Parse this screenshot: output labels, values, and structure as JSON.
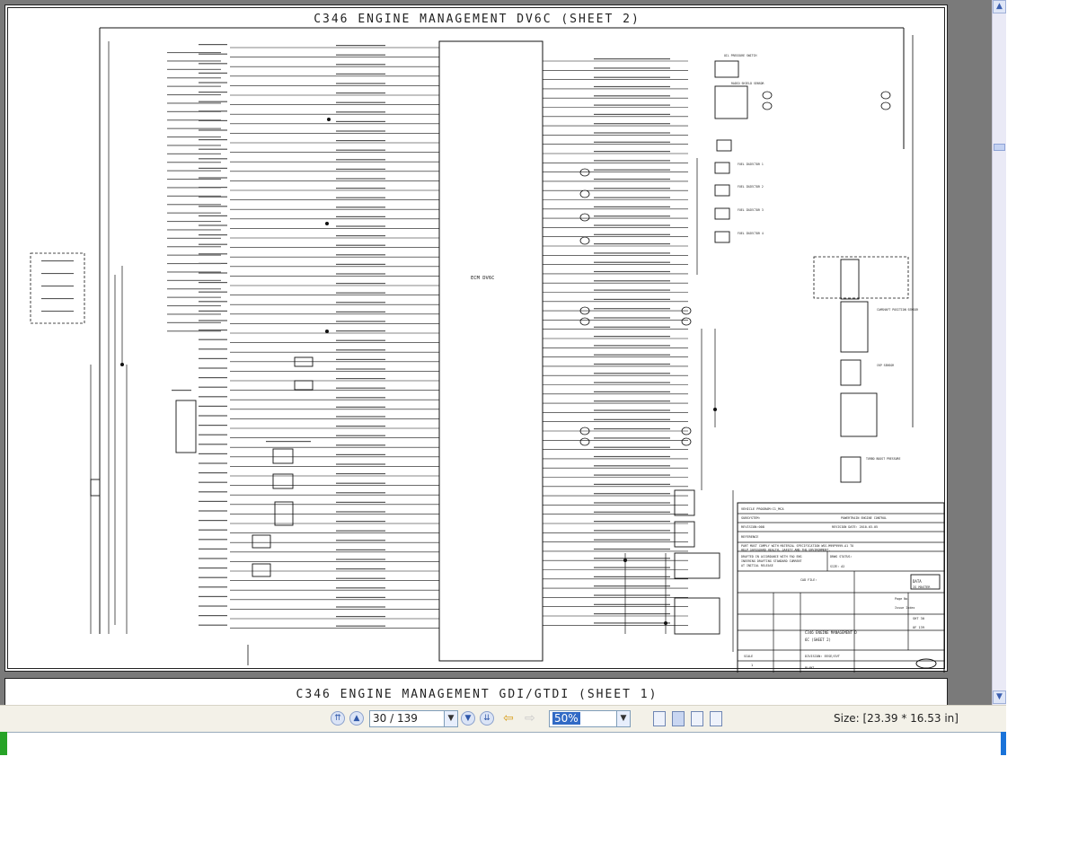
{
  "document": {
    "sheet_title": "C346  ENGINE MANAGEMENT DV6C (SHEET 2)",
    "next_sheet_title": "C346  ENGINE MANAGEMENT GDI/GTDI (SHEET 1)",
    "ecu_label": "ECM DV6C",
    "components_right": [
      "OIL PRESSURE SWITCH",
      "RADIO SHIELD SENSOR",
      "FUEL INJECTOR 1",
      "FUEL INJECTOR 2",
      "FUEL INJECTOR 3",
      "FUEL INJECTOR 4",
      "CAMSHAFT POSITION SENSOR",
      "CKP SENSOR",
      "TURBO BOOST PRESSURE"
    ],
    "title_block": {
      "vehicle_program": "VEHICLE PROGRAM:C1_MCA",
      "subsystem": "SUBSYSTEM:",
      "subsystem_value": "POWERTRAIN ENGINE CONTROL",
      "revision": "REVISION:008",
      "revision_date": "REVISION DATE: 2010-03-05",
      "reference": "REFERENCE",
      "compliance": "PART MUST COMPLY WITH MATERIAL SPECIFICATION WSS-M99P9999-A1 TO HELP SAFEGUARD HEALTH, SAFETY AND THE ENVIRONMENT.",
      "drafted": "DRAFTED IN ACCORDANCE WITH FAO ENGINEERING DRAFTING STANDARD CURRENT AT INITIAL RELEASE",
      "dwg_status": "DRWG STATUS:",
      "size": "SIZE: A2",
      "cad_file": "CAD FILE:",
      "data_is_master": "DATA IS MASTER",
      "drawing_title": "C346 ENGINE MANAGEMENT DV6C (SHEET 2)",
      "sheet_num": "SHT 30",
      "of_label": "OF  139",
      "division": "DIVISION: EESE/EVT",
      "plant": "PLANT",
      "scale_label": "SCALE",
      "scale_val": "1",
      "page_no": "Page No.",
      "issue_index": "Issue Index"
    }
  },
  "toolbar": {
    "page_value": "30 / 139",
    "zoom_value": "50%",
    "size_text": "Size: [23.39 * 16.53 in]"
  }
}
